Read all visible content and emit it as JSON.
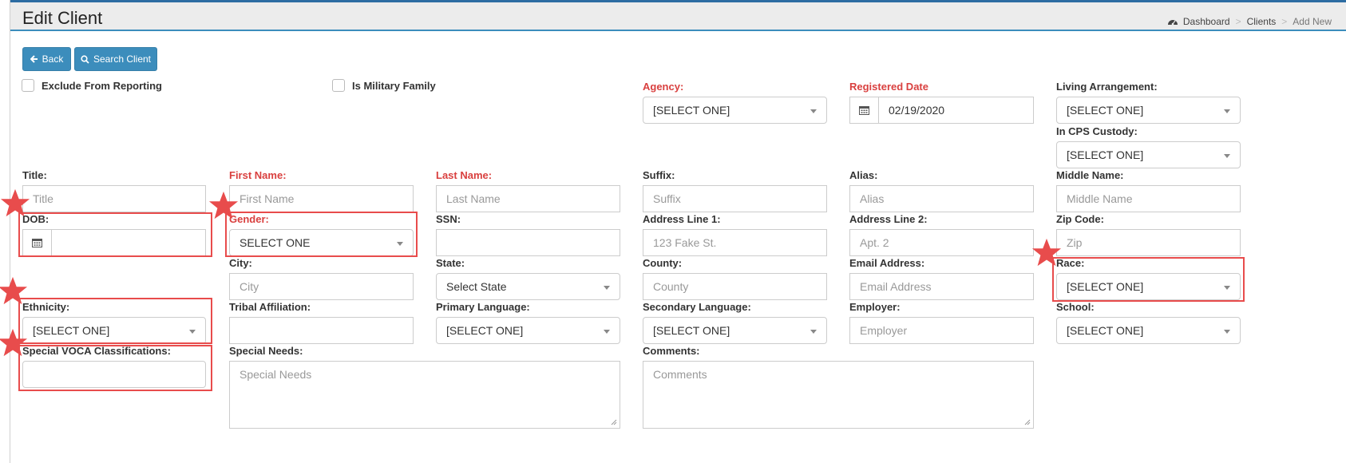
{
  "header": {
    "title": "Edit Client",
    "breadcrumb": [
      "Dashboard",
      "Clients",
      "Add New"
    ]
  },
  "toolbar": {
    "back_label": "Back",
    "search_label": "Search Client"
  },
  "checkboxes": {
    "exclude_reporting": "Exclude From Reporting",
    "military_family": "Is Military Family"
  },
  "labels": {
    "agency": "Agency:",
    "registered_date": "Registered Date",
    "living_arrangement": "Living Arrangement:",
    "cps_custody": "In CPS Custody:",
    "title": "Title:",
    "first_name": "First Name:",
    "last_name": "Last Name:",
    "suffix": "Suffix:",
    "alias": "Alias:",
    "middle_name": "Middle Name:",
    "dob": "DOB:",
    "gender": "Gender:",
    "ssn": "SSN:",
    "address1": "Address Line 1:",
    "address2": "Address Line 2:",
    "zip": "Zip Code:",
    "city": "City:",
    "state": "State:",
    "county": "County:",
    "email": "Email Address:",
    "race": "Race:",
    "ethnicity": "Ethnicity:",
    "tribal": "Tribal Affiliation:",
    "primary_language": "Primary Language:",
    "secondary_language": "Secondary Language:",
    "employer": "Employer:",
    "school": "School:",
    "voca": "Special VOCA Classifications:",
    "special_needs": "Special Needs:",
    "comments": "Comments:"
  },
  "placeholders": {
    "title": "Title",
    "first_name": "First Name",
    "last_name": "Last Name",
    "suffix": "Suffix",
    "alias": "Alias",
    "middle_name": "Middle Name",
    "address1": "123 Fake St.",
    "address2": "Apt. 2",
    "zip": "Zip",
    "city": "City",
    "county": "County",
    "email": "Email Address",
    "employer": "Employer",
    "special_needs": "Special Needs",
    "comments": "Comments"
  },
  "values": {
    "agency": "[SELECT ONE]",
    "registered_date": "02/19/2020",
    "living_arrangement": "[SELECT ONE]",
    "cps_custody": "[SELECT ONE]",
    "gender": "SELECT ONE",
    "state": "Select State",
    "race": "[SELECT ONE]",
    "ethnicity": "[SELECT ONE]",
    "primary_language": "[SELECT ONE]",
    "secondary_language": "[SELECT ONE]",
    "school": "[SELECT ONE]"
  },
  "colors": {
    "primary": "#3c8dbc",
    "required_label": "#d9403f",
    "highlight": "#e84c4c",
    "header_bg": "#ececec"
  },
  "icons": [
    "dashboard-icon",
    "arrow-left-icon",
    "search-icon",
    "calendar-icon",
    "chevron-down-icon",
    "resize-grip-icon",
    "star-icon"
  ]
}
